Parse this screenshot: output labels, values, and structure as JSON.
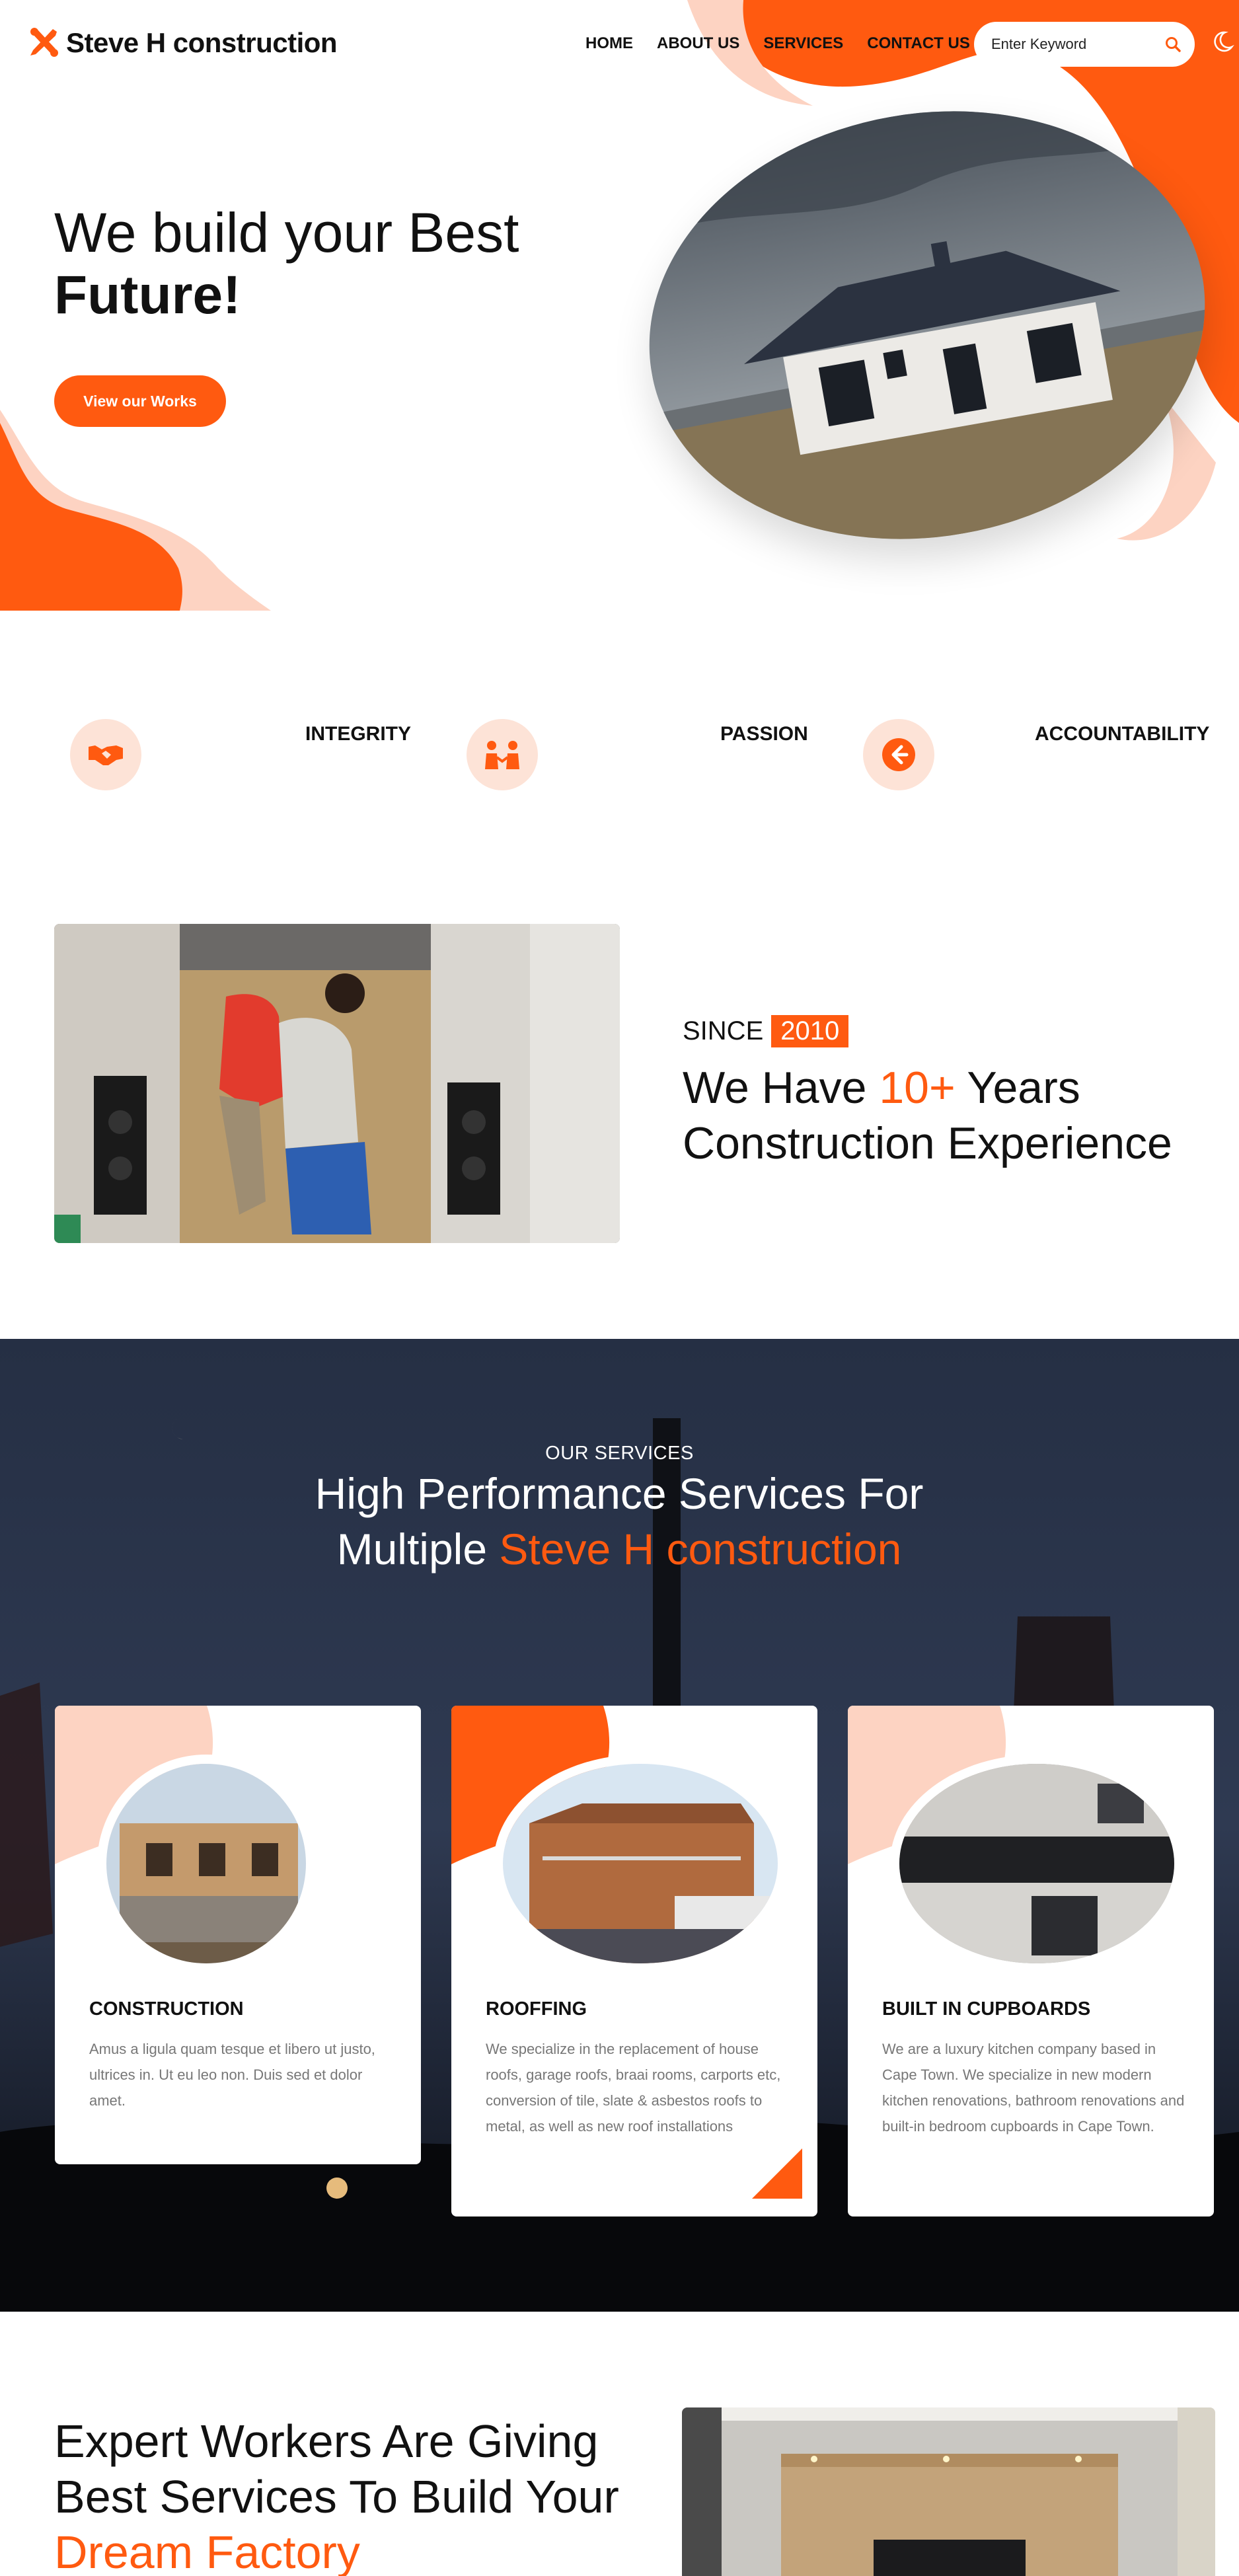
{
  "header": {
    "brand": "Steve H construction",
    "nav": [
      "HOME",
      "ABOUT US",
      "SERVICES",
      "CONTACT US"
    ],
    "search_placeholder": "Enter Keyword"
  },
  "hero": {
    "title_line1": "We build your Best",
    "title_line2": "Future!",
    "cta_label": "View our Works"
  },
  "values": [
    "INTEGRITY",
    "PASSION",
    "ACCOUNTABILITY"
  ],
  "about": {
    "since_label": "SINCE",
    "since_year": "2010",
    "title_pre": "We Have",
    "title_accent": "10+",
    "title_post": "Years Construction Experience"
  },
  "services": {
    "eyebrow": "OUR SERVICES",
    "title_main": "High Performance Services For Multiple",
    "title_accent": "Steve H construction",
    "cards": [
      {
        "title": "CONSTRUCTION",
        "text": "Amus a ligula quam tesque et libero ut justo, ultrices in. Ut eu leo non. Duis sed et dolor amet."
      },
      {
        "title": "ROOFFING",
        "text": "We specialize in the replacement of house roofs, garage roofs, braai rooms, carports etc, conversion of tile, slate & asbestos roofs to metal, as well as new roof installations"
      },
      {
        "title": "BUILT IN CUPBOARDS",
        "text": " We are a luxury kitchen company based in Cape Town. We specialize in new modern kitchen renovations, bathroom renovations and built-in bedroom cupboards in Cape Town."
      }
    ]
  },
  "expert": {
    "title_main": "Expert Workers Are Giving Best Services To Build Your",
    "title_accent": "Dream Factory"
  },
  "colors": {
    "accent": "#ff5a10",
    "accent_light": "#fdd3c2",
    "dark": "#111111"
  }
}
